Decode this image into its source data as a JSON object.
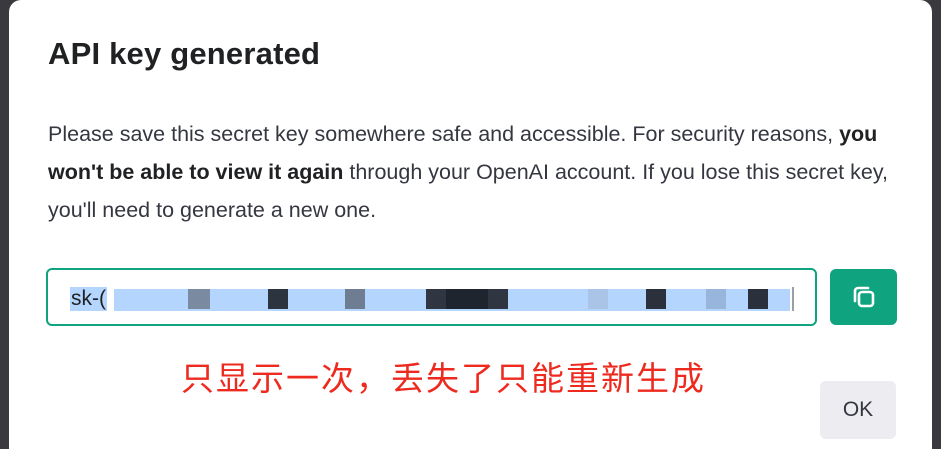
{
  "dialog": {
    "title": "API key generated",
    "description_part1": "Please save this secret key somewhere safe and accessible. For security reasons, ",
    "description_bold": "you won't be able to view it again",
    "description_part2": " through your OpenAI account. If you lose this secret key, you'll need to generate a new one.",
    "key_prefix": "sk-(",
    "annotation": "只显示一次，丢失了只能重新生成",
    "ok_label": "OK"
  },
  "icons": {
    "copy_button": "copy-icon"
  },
  "colors": {
    "accent": "#10a37f",
    "annotation_red": "#ee2a1f",
    "selection_blue": "#b4d5fe"
  }
}
